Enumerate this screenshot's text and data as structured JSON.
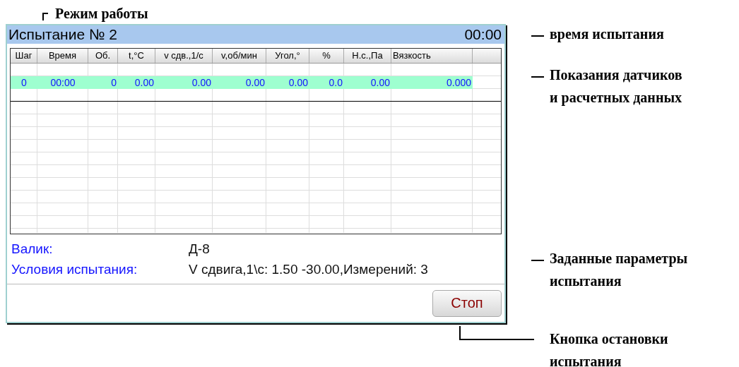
{
  "callouts": [
    {
      "kind": "corner",
      "text": "Режим работы"
    },
    {
      "kind": "dash",
      "text": "время испытания"
    },
    {
      "kind": "dash",
      "text": "Показания датчиков и расчетных данных"
    },
    {
      "kind": "dash",
      "text": "Заданные параметры испытания"
    },
    {
      "kind": "elbow",
      "text": "Кнопка остановки испытания"
    }
  ],
  "screen": {
    "title": "Испытание № 2",
    "timer": "00:00",
    "table": {
      "columns": [
        "Шаг",
        "Время",
        "Об.",
        "t,°C",
        "v сдв.,1/с",
        "v,об/мин",
        "Угол,°",
        "%",
        "Н.с.,Па",
        "Вязкость"
      ],
      "rows": [
        {
          "selected": true,
          "cells": [
            "0",
            "00:00",
            "0",
            "0.00",
            "0.00",
            "0.00",
            "0.00",
            "0.0",
            "0.00",
            "0.000"
          ]
        }
      ]
    },
    "params": [
      {
        "label": "Валик:",
        "value": "Д-8"
      },
      {
        "label": "Условия испытания:",
        "value": "V сдвига,1\\c: 1.50 ‑30.00,Измерений: 3"
      }
    ],
    "buttons": [
      "Стоп"
    ]
  }
}
